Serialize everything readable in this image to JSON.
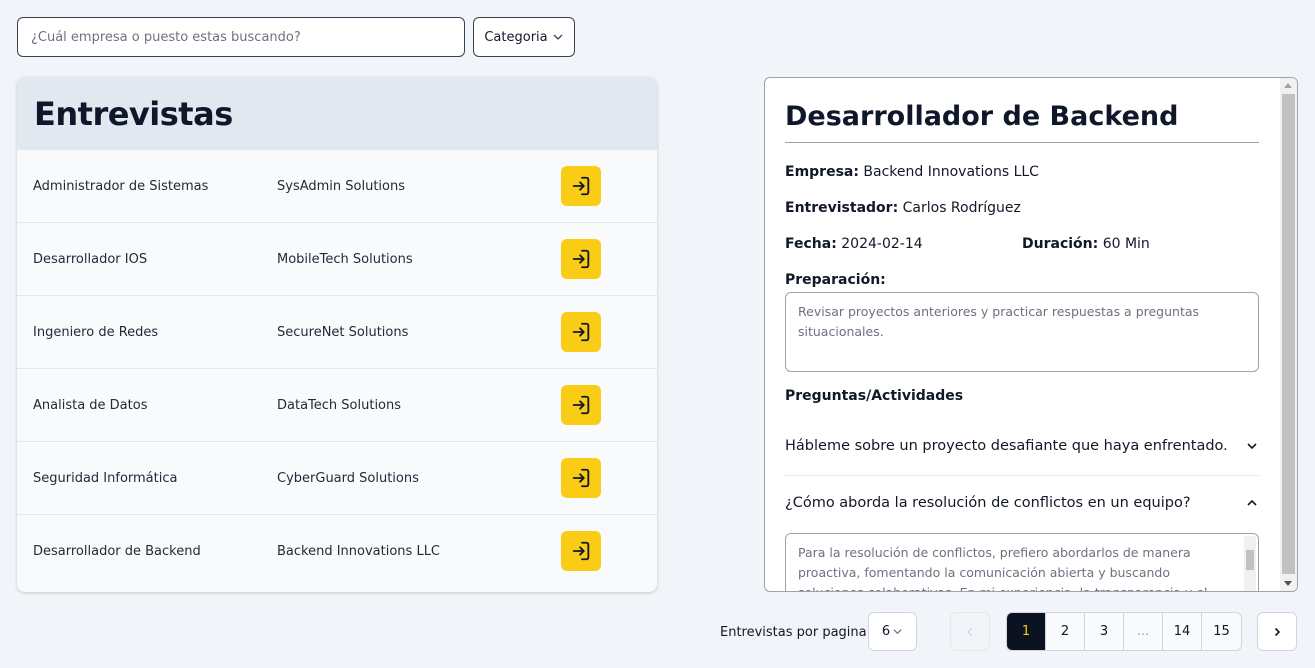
{
  "search": {
    "placeholder": "¿Cuál empresa o puesto estas buscando?"
  },
  "filter": {
    "category_label": "Categoria"
  },
  "list": {
    "title": "Entrevistas",
    "rows": [
      {
        "position": "Administrador de Sistemas",
        "company": "SysAdmin Solutions"
      },
      {
        "position": "Desarrollador IOS",
        "company": "MobileTech Solutions"
      },
      {
        "position": "Ingeniero de Redes",
        "company": "SecureNet Solutions"
      },
      {
        "position": "Analista de Datos",
        "company": "DataTech Solutions"
      },
      {
        "position": "Seguridad Informática",
        "company": "CyberGuard Solutions"
      },
      {
        "position": "Desarrollador de Backend",
        "company": "Backend Innovations LLC"
      }
    ]
  },
  "detail": {
    "title": "Desarrollador de Backend",
    "company_label": "Empresa:",
    "company": "Backend Innovations LLC",
    "interviewer_label": "Entrevistador:",
    "interviewer": "Carlos Rodríguez",
    "date_label": "Fecha:",
    "date": "2024-02-14",
    "duration_label": "Duración:",
    "duration": "60 Min",
    "prep_label": "Preparación:",
    "prep_text": "Revisar proyectos anteriores y practicar respuestas a preguntas situacionales.",
    "questions_label": "Preguntas/Actividades",
    "questions": [
      {
        "text": "Hábleme sobre un proyecto desafiante que haya enfrentado.",
        "expanded": false
      },
      {
        "text": "¿Cómo aborda la resolución de conflictos en un equipo?",
        "expanded": true,
        "answer": "Para la resolución de conflictos, prefiero abordarlos de manera proactiva, fomentando la comunicación abierta y buscando soluciones colaborativas. En mi experiencia, la transparencia y el"
      }
    ]
  },
  "pagination": {
    "per_page_label": "Entrevistas por pagina",
    "per_page_value": "6",
    "pages": [
      "1",
      "2",
      "3",
      "...",
      "14",
      "15"
    ],
    "current": "1"
  },
  "colors": {
    "accent": "#facc15",
    "dark": "#0b1222",
    "header_bg": "#e2e8f0"
  }
}
